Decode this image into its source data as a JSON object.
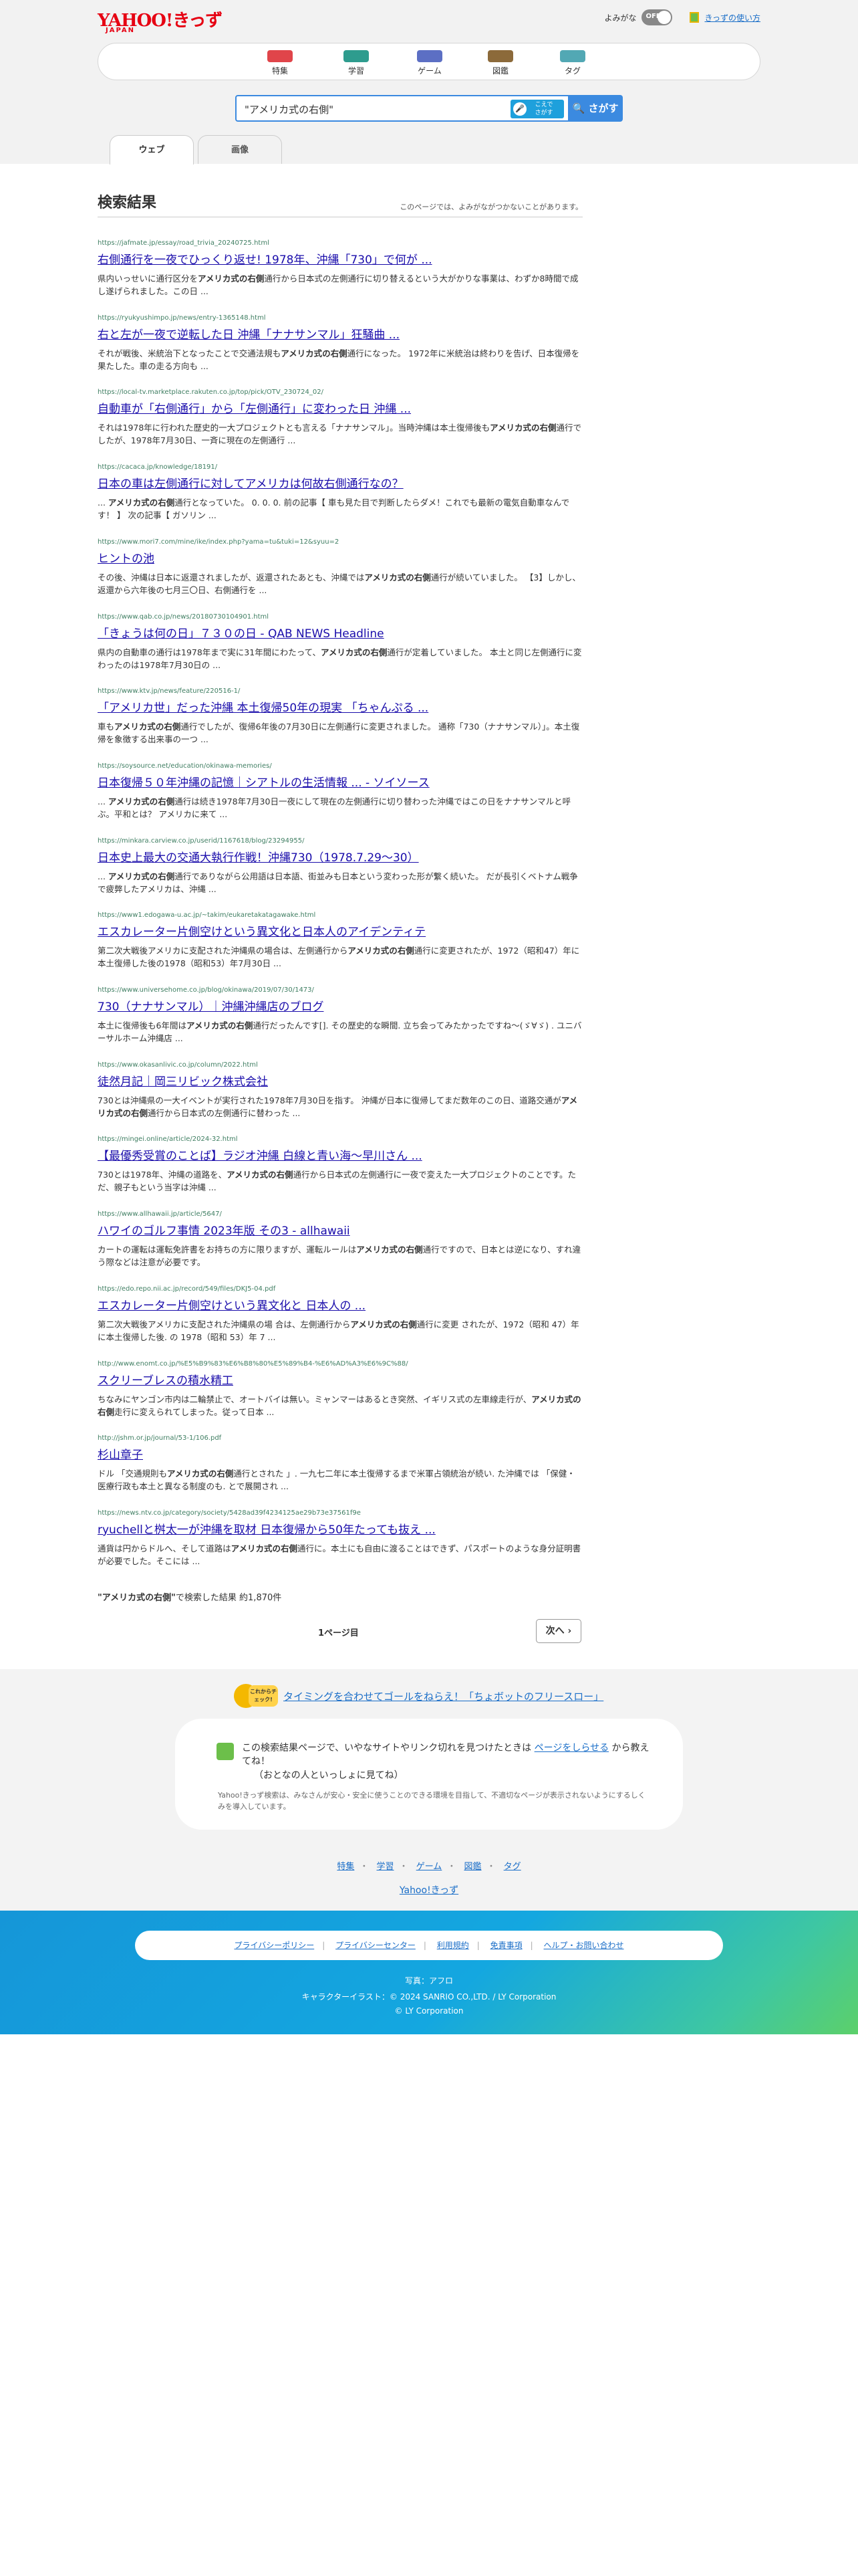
{
  "header": {
    "logo_main": "YAHOO!きっず",
    "logo_sub": "JAPAN",
    "reading_label": "よみがな",
    "toggle_state": "OFF",
    "guide_link": "きっずの使い方"
  },
  "nav": [
    {
      "label": "特集",
      "color": "#e0454a"
    },
    {
      "label": "学習",
      "color": "#2e9c8e"
    },
    {
      "label": "ゲーム",
      "color": "#5c6fc4"
    },
    {
      "label": "図鑑",
      "color": "#8c6a3a"
    },
    {
      "label": "タグ",
      "color": "#52a8b4"
    }
  ],
  "search": {
    "query": "\"アメリカ式の右側\"",
    "voice_label": "こえで\nさがす",
    "button": "さがす"
  },
  "tabs": [
    "ウェブ",
    "画像"
  ],
  "results_header": {
    "title": "検索結果",
    "note": "このページでは、よみがながつかないことがあります。"
  },
  "results": [
    {
      "url": "https://jafmate.jp/essay/road_trivia_20240725.html",
      "title": "右側通行を一夜でひっくり返せ! 1978年、沖縄「730」で何が ...",
      "snippet": "県内いっせいに通行区分を<b>アメリカ式の右側</b>通行から日本式の左側通行に切り替えるという大がかりな事業は、わずか8時間で成し遂げられました。この日 ..."
    },
    {
      "url": "https://ryukyushimpo.jp/news/entry-1365148.html",
      "title": "右と左が一夜で逆転した日 沖縄「ナナサンマル」狂騒曲 ...",
      "snippet": "それが戦後、米統治下となったことで交通法規も<b>アメリカ式の右側</b>通行になった。 1972年に米統治は終わりを告げ、日本復帰を果たした。車の走る方向も ..."
    },
    {
      "url": "https://local-tv.marketplace.rakuten.co.jp/top/pick/OTV_230724_02/",
      "title": "自動車が「右側通行」から「左側通行」に変わった日 沖縄 ...",
      "snippet": "それは1978年に行われた歴史的一大プロジェクトとも言える「ナナサンマル」。当時沖縄は本土復帰後も<b>アメリカ式の右側</b>通行でしたが、1978年7月30日、一斉に現在の左側通行 ..."
    },
    {
      "url": "https://cacaca.jp/knowledge/18191/",
      "title": "日本の車は左側通行に対してアメリカは何故右側通行なの？",
      "snippet": "... <b>アメリカ式の右側</b>通行となっていた。 0. 0. 0. 前の記事【 車も見た目で判断したらダメ！これでも最新の電気自動車なんです！ 】 次の記事【 ガソリン ..."
    },
    {
      "url": "https://www.mori7.com/mine/ike/index.php?yama=tu&tuki=12&syuu=2",
      "title": "ヒントの池",
      "snippet": "その後、沖縄は日本に返還されましたが、返還されたあとも、沖縄では<b>アメリカ式の右側</b>通行が続いていました。 【3】しかし、返還から六年後の七月三〇日、右側通行を ..."
    },
    {
      "url": "https://www.qab.co.jp/news/20180730104901.html",
      "title": "「きょうは何の日」７３０の日 - QAB NEWS Headline",
      "snippet": "県内の自動車の通行は1978年まで実に31年間にわたって、<b>アメリカ式の右側</b>通行が定着していました。 本土と同じ左側通行に変わったのは1978年7月30日の ..."
    },
    {
      "url": "https://www.ktv.jp/news/feature/220516-1/",
      "title": "「アメリカ世」だった沖縄 本土復帰50年の現実 「ちゃんぷる ...",
      "snippet": "車も<b>アメリカ式の右側</b>通行でしたが、復帰6年後の7月30日に左側通行に変更されました。 通称「730（ナナサンマル）」。本土復帰を象徴する出来事の一つ ..."
    },
    {
      "url": "https://soysource.net/education/okinawa-memories/",
      "title": "日本復帰５０年沖縄の記憶｜シアトルの生活情報 ... - ソイソース",
      "snippet": "... <b>アメリカ式の右側</b>通行は続き1978年7月30日一夜にして現在の左側通行に切り替わった沖縄ではこの日をナナサンマルと呼ぶ。平和とは？ アメリカに来て ..."
    },
    {
      "url": "https://minkara.carview.co.jp/userid/1167618/blog/23294955/",
      "title": "日本史上最大の交通大執行作戦！沖縄730（1978.7.29〜30）",
      "snippet": "... <b>アメリカ式の右側</b>通行でありながら公用語は日本語、街並みも日本という変わった形が繋く続いた。 だが長引くベトナム戦争で疲弊したアメリカは、沖縄 ..."
    },
    {
      "url": "https://www1.edogawa-u.ac.jp/~takim/eukaretakatagawake.html",
      "title": "エスカレーター片側空けという異文化と日本人のアイデンティテ",
      "snippet": "第二次大戦後アメリカに支配された沖縄県の場合は、左側通行から<b>アメリカ式の右側</b>通行に変更されたが、1972（昭和47）年に本土復帰した後の1978（昭和53）年7月30日 ..."
    },
    {
      "url": "https://www.universehome.co.jp/blog/okinawa/2019/07/30/1473/",
      "title": "730（ナナサンマル）｜沖縄沖縄店のブログ",
      "snippet": "本土に復帰後も6年間は<b>アメリカ式の右側</b>通行だったんです[]. その歴史的な瞬間. 立ち会ってみたかったですね〜(ゞ∀ゞ) . ユニバーサルホーム沖縄店 ..."
    },
    {
      "url": "https://www.okasanlivic.co.jp/column/2022.html",
      "title": "徒然月記｜岡三リビック株式会社",
      "snippet": "730とは沖縄県の一大イベントが実行された1978年7月30日を指す。 沖縄が日本に復帰してまだ数年のこの日、道路交通が<b>アメリカ式の右側</b>通行から日本式の左側通行に替わった ..."
    },
    {
      "url": "https://mingei.online/article/2024-32.html",
      "title": "【最優秀受賞のことば】ラジオ沖縄 白線と青い海〜早川さん ...",
      "snippet": "730とは1978年、沖縄の道路を、<b>アメリカ式の右側</b>通行から日本式の左側通行に一夜で変えた一大プロジェクトのことです。ただ、親子もという当字は沖縄 ..."
    },
    {
      "url": "https://www.allhawaii.jp/article/5647/",
      "title": "ハワイのゴルフ事情 2023年版 その3 - allhawaii",
      "snippet": "カートの運転は運転免許書をお持ちの方に限りますが、運転ルールは<b>アメリカ式の右側</b>通行ですので、日本とは逆になり、すれ違う際などは注意が必要です。"
    },
    {
      "url": "https://edo.repo.nii.ac.jp/record/549/files/DKJ5-04.pdf",
      "title": "エスカレーター片側空けという異文化と 日本人の ...",
      "snippet": "第二次大戦後アメリカに支配された沖縄県の場 合は、左側通行から<b>アメリカ式の右側</b>通行に変更 されたが、1972（昭和 47）年に本土復帰した後. の 1978（昭和 53）年 7 ..."
    },
    {
      "url": "http://www.enomt.co.jp/%E5%B9%83%E6%B8%80%E5%89%B4-%E6%AD%A3%E6%9C%88/",
      "title": "スクリーブレスの積水精工",
      "snippet": "ちなみにヤンゴン市内は二輪禁止で、オートバイは無い。ミャンマーはあるとき突然、イギリス式の左車線走行が、<b>アメリカ式の右側</b>走行に変えられてしまった。従って日本 ..."
    },
    {
      "url": "http://jshm.or.jp/journal/53-1/106.pdf",
      "title": "杉山章子",
      "snippet": "ドル 「交通規則も<b>アメリカ式の右側</b>通行とされた 」. 一九七二年に本土復帰するまで米軍占領統治が続い. た沖縄では 「保健・医療行政も本土と異なる制度のも. とで展開され ..."
    },
    {
      "url": "https://news.ntv.co.jp/category/society/5428ad39f4234125ae29b73e37561f9e",
      "title": "ryuchellと桝太一が沖縄を取材 日本復帰から50年たっても抜え ...",
      "snippet": "通貨は円からドルへ、そして道路は<b>アメリカ式の右側</b>通行に。本土にも自由に渡ることはできず、パスポートのような身分証明書が必要でした。そこには ..."
    }
  ],
  "summary": {
    "query": "\"アメリカ式の右側\"",
    "suffix": "で検索した結果 約1,870件",
    "page": "1ページ目",
    "next": "次へ"
  },
  "footer": {
    "promo_badge": "これからチェック!",
    "promo_link": "タイミングを合わせてゴールをねらえ！「ちょボットのフリースロー」",
    "info_line1": "この検索結果ページで、いやなサイトやリンク切れを見つけたときは",
    "info_link": "ページをしらせる",
    "info_line1_end": "から教えてね！",
    "info_line2": "（おとなの人といっしょに見てね）",
    "info_line3": "Yahoo!きっず検索は、みなさんが安心・安全に使うことのできる環境を目指して、不適切なページが表示されないようにするしくみを導入しています。",
    "links": [
      "特集",
      "学習",
      "ゲーム",
      "図鑑",
      "タグ"
    ],
    "yahoo_link": "Yahoo!きっず",
    "legal": [
      "プライバシーポリシー",
      "プライバシーセンター",
      "利用規約",
      "免責事項",
      "ヘルプ・お問い合わせ"
    ],
    "credit_photo": "写真：アフロ",
    "credit_character": "キャラクターイラスト：© 2024 SANRIO CO.,LTD. / LY Corporation",
    "copyright": "© LY Corporation"
  }
}
